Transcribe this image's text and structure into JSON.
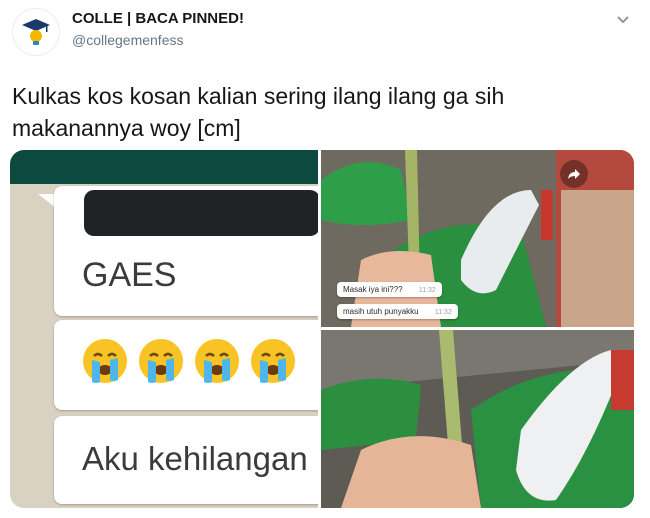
{
  "tweet": {
    "display_name": "COLLE | BACA PINNED!",
    "handle": "@collegemenfess",
    "text": "Kulkas kos kosan kalian sering ilang ilang ga sih makanannya woy [cm]"
  },
  "media": {
    "chat": {
      "message_1": "GAES",
      "message_2_emoji": [
        "😭",
        "😭",
        "😭",
        "😭"
      ],
      "message_3": "Aku kehilangan"
    },
    "photo_top": {
      "caption_1": "Masak iya ini???",
      "caption_1_time": "11:32",
      "caption_2": "masih utuh punyakku",
      "caption_2_time": "11:32"
    }
  },
  "icons": {
    "avatar": "graduation-cap-bulb-icon",
    "caret": "chevron-down-icon",
    "share": "share-arrow-icon"
  },
  "colors": {
    "text": "#14171a",
    "secondary_text": "#657786",
    "chat_header": "#0c4a3f"
  }
}
